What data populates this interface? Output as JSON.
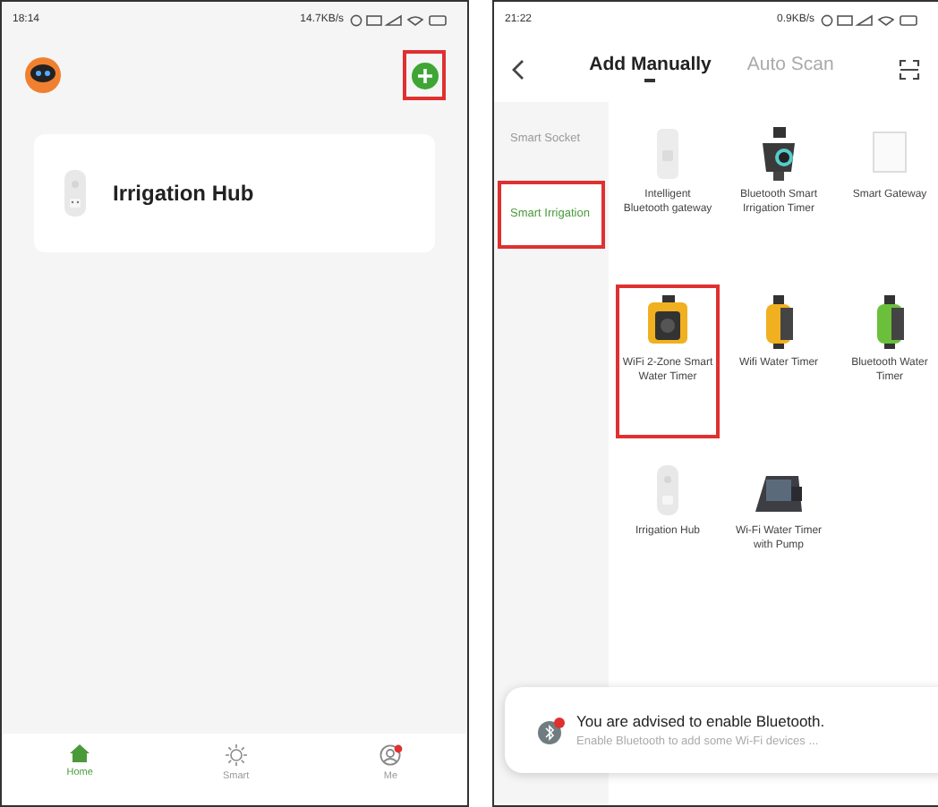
{
  "home_screen": {
    "status_bar": {
      "time": "18:14",
      "speed": "14.7KB/s"
    },
    "add_button": {
      "highlighted": true
    },
    "devices": [
      {
        "name": "Irrigation Hub"
      }
    ],
    "nav": [
      {
        "label": "Home",
        "selected": true,
        "kind": "home"
      },
      {
        "label": "Smart",
        "selected": false,
        "kind": "smart"
      },
      {
        "label": "Me",
        "selected": false,
        "kind": "me"
      }
    ]
  },
  "add_screen": {
    "status_bar": {
      "time": "21:22",
      "speed": "0.9KB/s"
    },
    "tabs": [
      {
        "label": "Add Manually",
        "selected": true
      },
      {
        "label": "Auto Scan",
        "selected": false
      }
    ],
    "categories": [
      {
        "label": "Smart Socket",
        "selected": false,
        "highlighted": false
      },
      {
        "label": "Smart Irrigation",
        "selected": true,
        "highlighted": true
      }
    ],
    "products": [
      {
        "name": "Intelligent Bluetooth gateway",
        "kind": "gateway",
        "highlighted": false
      },
      {
        "name": "Bluetooth Smart Irrigation Timer",
        "kind": "bt-timer",
        "highlighted": false
      },
      {
        "name": "Smart Gateway",
        "kind": "gateway-box",
        "highlighted": false
      },
      {
        "name": "WiFi 2-Zone Smart Water Timer",
        "kind": "yellow-2zone",
        "highlighted": true
      },
      {
        "name": "Wifi Water Timer",
        "kind": "yellow-timer",
        "highlighted": false
      },
      {
        "name": "Bluetooth Water Timer",
        "kind": "green-timer",
        "highlighted": false
      },
      {
        "name": "Irrigation Hub",
        "kind": "plug",
        "highlighted": false
      },
      {
        "name": "Wi-Fi Water Timer with Pump",
        "kind": "pump",
        "highlighted": false
      }
    ],
    "notice": {
      "title": "You are advised to enable Bluetooth.",
      "text": "Enable Bluetooth to add some Wi-Fi devices ..."
    }
  }
}
